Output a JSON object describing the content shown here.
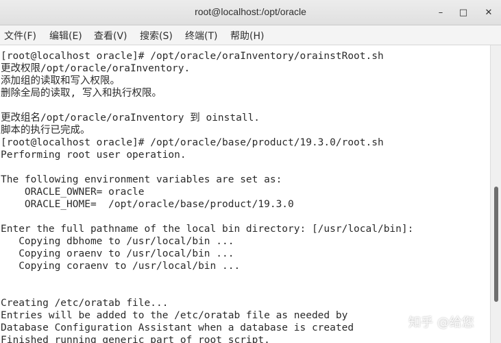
{
  "window": {
    "title": "root@localhost:/opt/oracle",
    "controls": {
      "minimize_glyph": "–",
      "maximize_glyph": "□",
      "close_glyph": "✕"
    }
  },
  "menubar": {
    "items": [
      {
        "label": "文件(F)"
      },
      {
        "label": "编辑(E)"
      },
      {
        "label": "查看(V)"
      },
      {
        "label": "搜索(S)"
      },
      {
        "label": "终端(T)"
      },
      {
        "label": "帮助(H)"
      }
    ]
  },
  "terminal": {
    "lines": [
      "[root@localhost oracle]# /opt/oracle/oraInventory/orainstRoot.sh",
      "更改权限/opt/oracle/oraInventory.",
      "添加组的读取和写入权限。",
      "删除全局的读取, 写入和执行权限。",
      "",
      "更改组名/opt/oracle/oraInventory 到 oinstall.",
      "脚本的执行已完成。",
      "[root@localhost oracle]# /opt/oracle/base/product/19.3.0/root.sh",
      "Performing root user operation.",
      "",
      "The following environment variables are set as:",
      "    ORACLE_OWNER= oracle",
      "    ORACLE_HOME=  /opt/oracle/base/product/19.3.0",
      "",
      "Enter the full pathname of the local bin directory: [/usr/local/bin]:",
      "   Copying dbhome to /usr/local/bin ...",
      "   Copying oraenv to /usr/local/bin ...",
      "   Copying coraenv to /usr/local/bin ...",
      "",
      "",
      "Creating /etc/oratab file...",
      "Entries will be added to the /etc/oratab file as needed by",
      "Database Configuration Assistant when a database is created",
      "Finished running generic part of root script."
    ]
  },
  "scrollbar": {
    "position": 0.78
  },
  "watermark": {
    "text": "知乎 @给您"
  }
}
